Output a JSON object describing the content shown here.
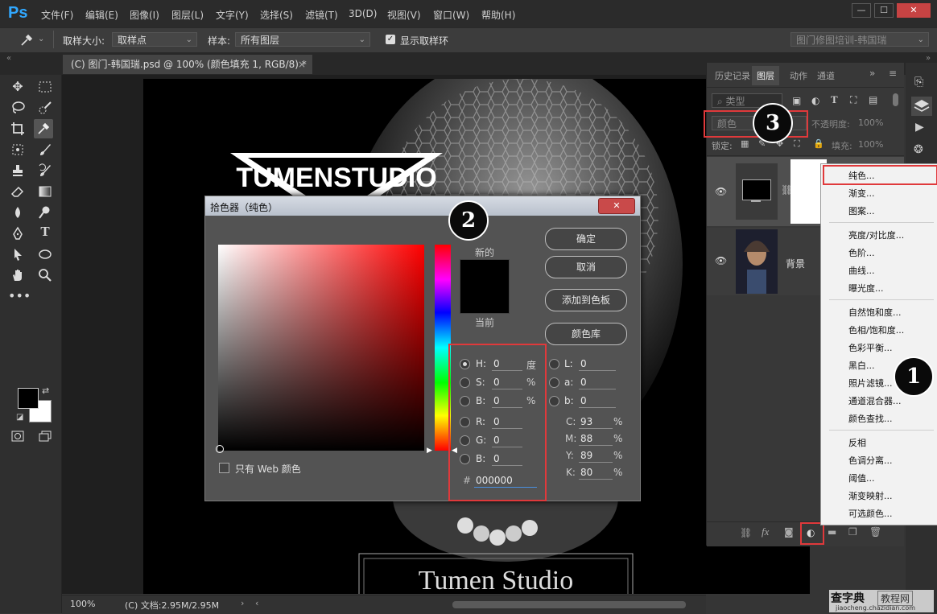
{
  "menu": {
    "logo": "Ps",
    "items": [
      "文件(F)",
      "编辑(E)",
      "图像(I)",
      "图层(L)",
      "文字(Y)",
      "选择(S)",
      "滤镜(T)",
      "3D(D)",
      "视图(V)",
      "窗口(W)",
      "帮助(H)"
    ],
    "window_buttons": [
      "—",
      "☐",
      "✕"
    ]
  },
  "options": {
    "sample_size_label": "取样大小:",
    "sample_size_value": "取样点",
    "sample_label": "样本:",
    "sample_value": "所有图层",
    "show_ring_label": "显示取样环",
    "workspace_value": "图门修图培训-韩国瑞"
  },
  "document_tab": {
    "title": "(C) 图门-韩国瑞.psd @ 100% (颜色填充 1, RGB/8) *",
    "close": "×"
  },
  "canvas": {
    "logo_text": "TUMENSTUDIO",
    "footer_text": "Tumen Studio"
  },
  "status": {
    "zoom": "100%",
    "doc_info": "(C) 文档:2.95M/2.95M"
  },
  "color_picker": {
    "title": "拾色器（纯色）",
    "close": "✕",
    "new_label": "新的",
    "current_label": "当前",
    "ok": "确定",
    "cancel": "取消",
    "add_swatch": "添加到色板",
    "libraries": "颜色库",
    "web_only": "只有 Web 颜色",
    "hsb": [
      {
        "label": "H:",
        "value": "0",
        "unit": "度"
      },
      {
        "label": "S:",
        "value": "0",
        "unit": "%"
      },
      {
        "label": "B:",
        "value": "0",
        "unit": "%"
      }
    ],
    "rgb": [
      {
        "label": "R:",
        "value": "0"
      },
      {
        "label": "G:",
        "value": "0"
      },
      {
        "label": "B:",
        "value": "0"
      }
    ],
    "lab": [
      {
        "label": "L:",
        "value": "0"
      },
      {
        "label": "a:",
        "value": "0"
      },
      {
        "label": "b:",
        "value": "0"
      }
    ],
    "cmyk": [
      {
        "label": "C:",
        "value": "93",
        "unit": "%"
      },
      {
        "label": "M:",
        "value": "88",
        "unit": "%"
      },
      {
        "label": "Y:",
        "value": "89",
        "unit": "%"
      },
      {
        "label": "K:",
        "value": "80",
        "unit": "%"
      }
    ],
    "hex_label": "#",
    "hex_value": "000000",
    "new_color": "#000000",
    "gradient_hue": "#ff0000"
  },
  "layers_panel": {
    "tabs": [
      "历史记录",
      "图层",
      "动作",
      "通道"
    ],
    "kind_label": "类型",
    "blend_mode": "颜色",
    "opacity_label": "不透明度:",
    "opacity_value": "100%",
    "lock_label": "锁定:",
    "fill_label": "填充:",
    "fill_value": "100%",
    "layers": [
      {
        "name": "",
        "type": "color-fill"
      },
      {
        "name": "背景",
        "type": "image"
      }
    ]
  },
  "context_menu": {
    "groups": [
      [
        "纯色...",
        "渐变...",
        "图案..."
      ],
      [
        "亮度/对比度...",
        "色阶...",
        "曲线...",
        "曝光度..."
      ],
      [
        "自然饱和度...",
        "色相/饱和度...",
        "色彩平衡...",
        "黑白...",
        "照片滤镜...",
        "通道混合器...",
        "颜色查找..."
      ],
      [
        "反相",
        "色调分离...",
        "阈值...",
        "渐变映射...",
        "可选颜色..."
      ]
    ]
  },
  "badges": [
    "1",
    "2",
    "3"
  ],
  "watermark": {
    "main": "查字典",
    "sub": "教程网",
    "url": "jiaocheng.chazidian.com"
  }
}
